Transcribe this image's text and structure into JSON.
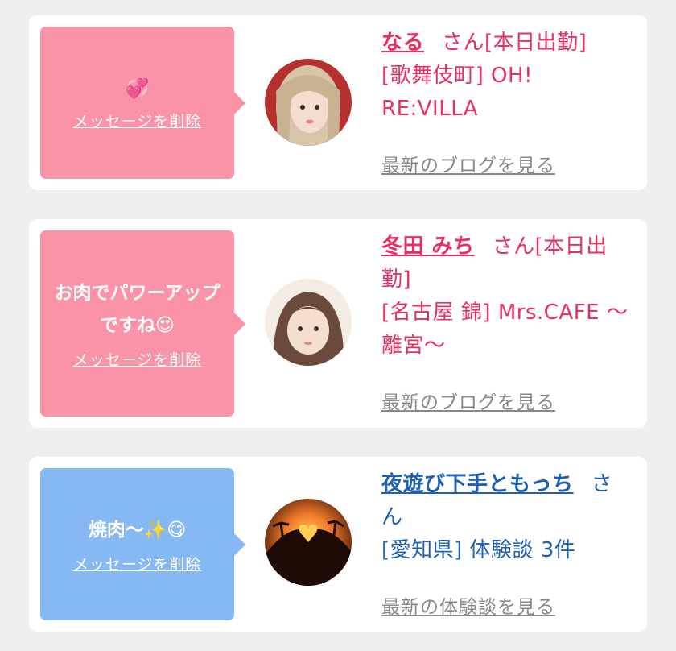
{
  "cards": [
    {
      "message": "",
      "message_emoji": "💞",
      "delete_label": "メッセージを削除",
      "name": "なる",
      "honorific": "さん[本日出勤]",
      "shop": "[歌舞伎町] OH! RE:VILLA",
      "blog_link": "最新のブログを見る",
      "theme": "#fb93a8"
    },
    {
      "message": "お肉でパワーアップですね",
      "message_emoji": "😍",
      "delete_label": "メッセージを削除",
      "name": "冬田 みち",
      "honorific": "さん[本日出勤]",
      "shop": "[名古屋 錦] Mrs.CAFE 〜離宮〜",
      "blog_link": "最新のブログを見る",
      "theme": "#fb93a8"
    },
    {
      "message": "焼肉〜",
      "message_emoji": "✨😋",
      "delete_label": "メッセージを削除",
      "name": "夜遊び下手ともっち",
      "honorific": "さん",
      "shop": "[愛知県] 体験談 3件",
      "blog_link": "最新の体験談を見る",
      "theme": "#86b9f4"
    }
  ]
}
